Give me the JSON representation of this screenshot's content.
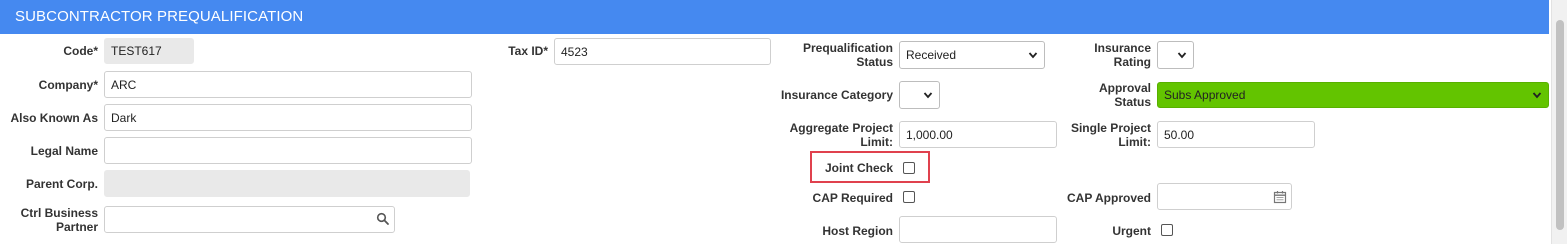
{
  "header": {
    "title": "SUBCONTRACTOR PREQUALIFICATION"
  },
  "fields": {
    "code": {
      "label": "Code*",
      "value": "TEST617"
    },
    "company": {
      "label": "Company*",
      "value": "ARC"
    },
    "aka": {
      "label": "Also Known As",
      "value": "Dark"
    },
    "legal_name": {
      "label": "Legal Name",
      "value": ""
    },
    "parent_corp": {
      "label": "Parent Corp.",
      "value": ""
    },
    "ctrl_partner": {
      "label_line1": "Ctrl Business",
      "label_line2": "Partner",
      "value": ""
    },
    "tax_id": {
      "label": "Tax ID*",
      "value": "4523"
    },
    "prequal_status": {
      "label_line1": "Prequalification",
      "label_line2": "Status",
      "value": "Received"
    },
    "insurance_category": {
      "label": "Insurance Category",
      "value": ""
    },
    "aggregate_limit": {
      "label_line1": "Aggregate Project",
      "label_line2": "Limit:",
      "value": "1,000.00"
    },
    "joint_check": {
      "label": "Joint Check",
      "checked": false
    },
    "cap_required": {
      "label": "CAP Required",
      "checked": false
    },
    "host_region": {
      "label": "Host Region",
      "value": ""
    },
    "insurance_rating": {
      "label_line1": "Insurance",
      "label_line2": "Rating",
      "value": ""
    },
    "approval_status": {
      "label_line1": "Approval",
      "label_line2": "Status",
      "value": "Subs Approved",
      "color": "#63c400"
    },
    "single_limit": {
      "label_line1": "Single Project",
      "label_line2": "Limit:",
      "value": "50.00"
    },
    "cap_approved": {
      "label": "CAP Approved",
      "value": ""
    },
    "urgent": {
      "label": "Urgent",
      "checked": false
    }
  },
  "icons": {
    "search": "search-icon",
    "calendar": "calendar-icon",
    "dropdown": "chevron-down-icon"
  },
  "colors": {
    "header": "#4589f0",
    "highlight": "#e0414e",
    "approved": "#63c400"
  }
}
